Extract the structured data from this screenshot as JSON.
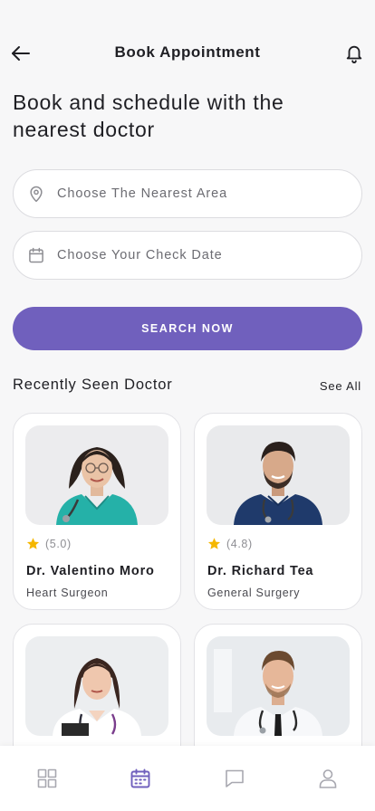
{
  "header": {
    "title": "Book Appointment"
  },
  "headline": "Book and schedule with the nearest doctor",
  "search": {
    "area_placeholder": "Choose The Nearest Area",
    "date_placeholder": "Choose Your Check Date",
    "button_label": "SEARCH NOW"
  },
  "recent": {
    "title": "Recently Seen Doctor",
    "see_all": "See All",
    "doctors": [
      {
        "rating": "(5.0)",
        "name": "Dr. Valentino Moro",
        "specialty": "Heart Surgeon"
      },
      {
        "rating": "(4.8)",
        "name": "Dr. Richard Tea",
        "specialty": "General Surgery"
      },
      {
        "rating": "",
        "name": "",
        "specialty": ""
      },
      {
        "rating": "",
        "name": "",
        "specialty": ""
      }
    ]
  },
  "bottom_nav": {
    "items": [
      {
        "icon": "grid-icon",
        "active": false
      },
      {
        "icon": "calendar-icon",
        "active": true
      },
      {
        "icon": "chat-icon",
        "active": false
      },
      {
        "icon": "profile-icon",
        "active": false
      }
    ]
  },
  "colors": {
    "accent": "#7060bd",
    "star": "#f5b700",
    "nav_inactive": "#a8a8b0",
    "background": "#f7f7f8"
  }
}
